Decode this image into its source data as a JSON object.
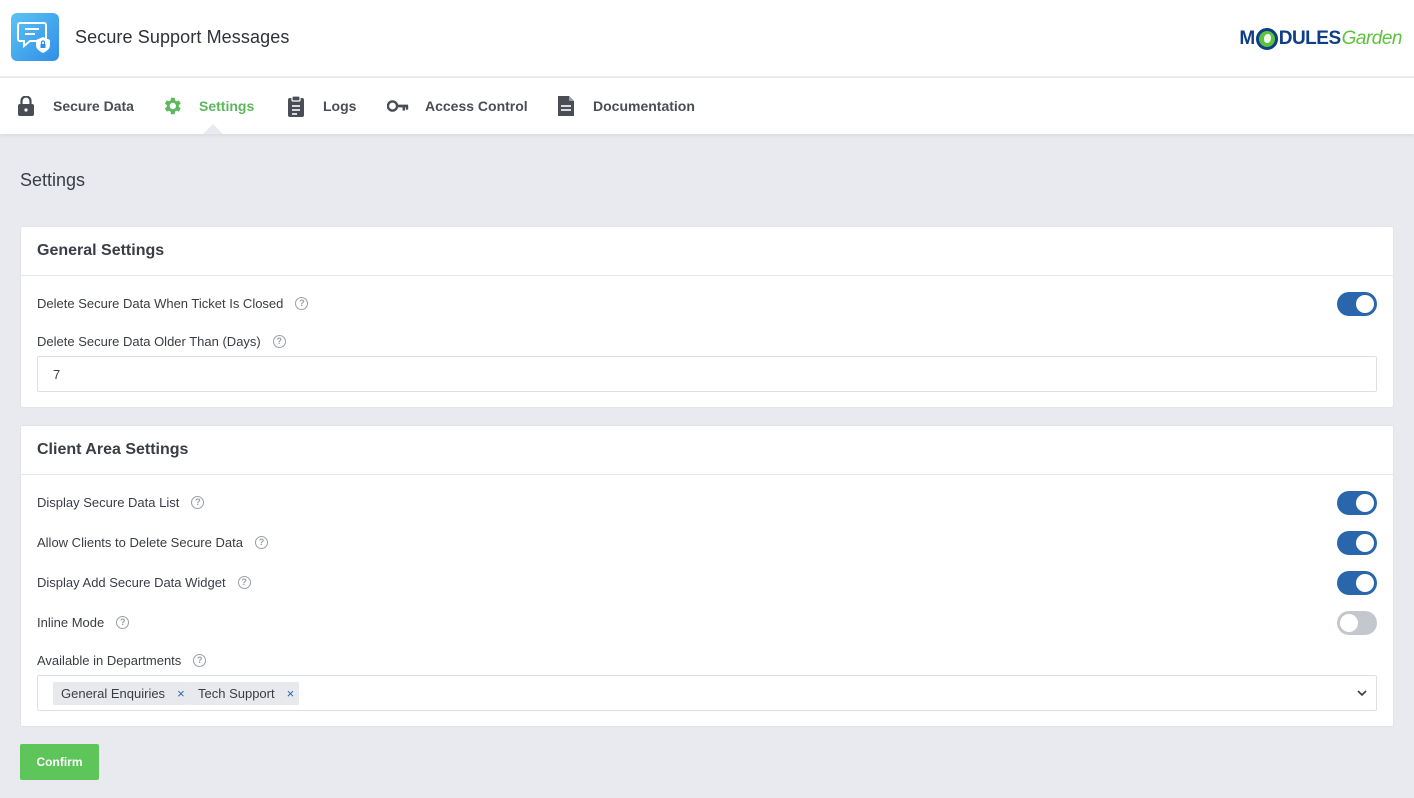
{
  "app": {
    "title": "Secure Support Messages",
    "logo_icon": "secure-message-icon"
  },
  "brand": {
    "part1": "M",
    "part2": "DULES",
    "part3": "Garden",
    "colors": {
      "navy": "#0e3e86",
      "green": "#5dc23d"
    }
  },
  "nav": {
    "items": [
      {
        "label": "Secure Data",
        "icon": "lock-icon"
      },
      {
        "label": "Settings",
        "icon": "gear-icon",
        "active": true
      },
      {
        "label": "Logs",
        "icon": "clipboard-icon"
      },
      {
        "label": "Access Control",
        "icon": "key-icon"
      },
      {
        "label": "Documentation",
        "icon": "document-icon"
      }
    ]
  },
  "page": {
    "title": "Settings"
  },
  "general": {
    "title": "General Settings",
    "delete_when_closed": {
      "label": "Delete Secure Data When Ticket Is Closed",
      "enabled": true
    },
    "delete_older_than": {
      "label": "Delete Secure Data Older Than (Days)",
      "value": "7"
    }
  },
  "client_area": {
    "title": "Client Area Settings",
    "display_list": {
      "label": "Display Secure Data List",
      "enabled": true
    },
    "allow_delete": {
      "label": "Allow Clients to Delete Secure Data",
      "enabled": true
    },
    "display_widget": {
      "label": "Display Add Secure Data Widget",
      "enabled": true
    },
    "inline_mode": {
      "label": "Inline Mode",
      "enabled": false
    },
    "departments": {
      "label": "Available in Departments",
      "selected": [
        "General Enquiries",
        "Tech Support"
      ],
      "remove_glyph": "×"
    }
  },
  "actions": {
    "confirm_label": "Confirm"
  },
  "colors": {
    "accent_green": "#5bb85c",
    "toggle_on": "#2a66ab",
    "toggle_off": "#c4c7cd",
    "button_green": "#5dc55a"
  }
}
